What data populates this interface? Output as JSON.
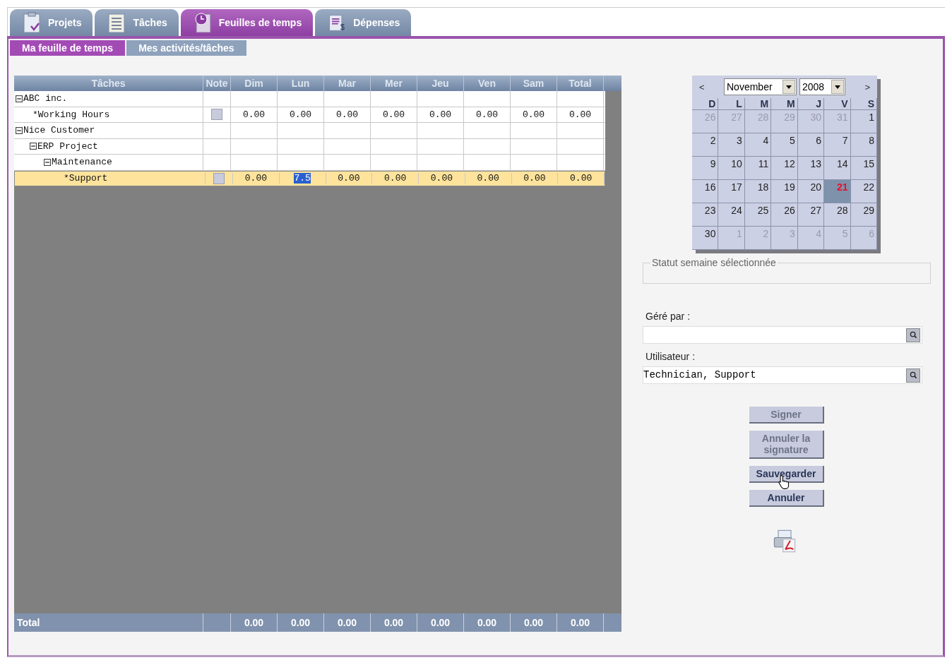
{
  "tabs": [
    {
      "label": "Projets",
      "selected": false
    },
    {
      "label": "Tâches",
      "selected": false
    },
    {
      "label": "Feuilles de temps",
      "selected": true
    },
    {
      "label": "Dépenses",
      "selected": false
    }
  ],
  "subtabs": [
    {
      "label": "Ma feuille de temps",
      "selected": true
    },
    {
      "label": "Mes activités/tâches",
      "selected": false
    }
  ],
  "grid": {
    "columns": [
      "Tâches",
      "Note",
      "Dim",
      "Lun",
      "Mar",
      "Mer",
      "Jeu",
      "Ven",
      "Sam",
      "Total"
    ],
    "rows": [
      {
        "kind": "group",
        "label": "ABC inc.",
        "expanded": true,
        "children": [
          {
            "kind": "task",
            "label": "*Working Hours",
            "selected": false,
            "cells": [
              {
                "text": "0.00",
                "editing": false
              },
              {
                "text": "0.00",
                "editing": false
              },
              {
                "text": "0.00",
                "editing": false
              },
              {
                "text": "0.00",
                "editing": false
              },
              {
                "text": "0.00",
                "editing": false
              },
              {
                "text": "0.00",
                "editing": false
              },
              {
                "text": "0.00",
                "editing": false
              },
              {
                "text": "0.00",
                "editing": false
              }
            ]
          }
        ]
      },
      {
        "kind": "group",
        "label": "Nice Customer",
        "expanded": true,
        "children": [
          {
            "kind": "group",
            "label": "ERP Project",
            "expanded": true,
            "children": [
              {
                "kind": "group",
                "label": "Maintenance",
                "expanded": true,
                "children": [
                  {
                    "kind": "task",
                    "label": "*Support",
                    "selected": true,
                    "cells": [
                      {
                        "text": "0.00",
                        "editing": false
                      },
                      {
                        "text": "7.5",
                        "editing": true
                      },
                      {
                        "text": "0.00",
                        "editing": false
                      },
                      {
                        "text": "0.00",
                        "editing": false
                      },
                      {
                        "text": "0.00",
                        "editing": false
                      },
                      {
                        "text": "0.00",
                        "editing": false
                      },
                      {
                        "text": "0.00",
                        "editing": false
                      },
                      {
                        "text": "0.00",
                        "editing": false
                      }
                    ]
                  }
                ]
              }
            ]
          }
        ]
      }
    ],
    "total": {
      "label": "Total",
      "values": [
        "0.00",
        "0.00",
        "0.00",
        "0.00",
        "0.00",
        "0.00",
        "0.00",
        "0.00"
      ]
    }
  },
  "calendar": {
    "prev": "<",
    "next": ">",
    "month": "November",
    "year": "2008",
    "weekdays": [
      "D",
      "L",
      "M",
      "M",
      "J",
      "V",
      "S"
    ],
    "weeks": [
      [
        {
          "text": "26",
          "outside": true,
          "selected": false
        },
        {
          "text": "27",
          "outside": true,
          "selected": false
        },
        {
          "text": "28",
          "outside": true,
          "selected": false
        },
        {
          "text": "29",
          "outside": true,
          "selected": false
        },
        {
          "text": "30",
          "outside": true,
          "selected": false
        },
        {
          "text": "31",
          "outside": true,
          "selected": false
        },
        {
          "text": "1",
          "outside": false,
          "selected": false
        }
      ],
      [
        {
          "text": "2",
          "outside": false,
          "selected": false
        },
        {
          "text": "3",
          "outside": false,
          "selected": false
        },
        {
          "text": "4",
          "outside": false,
          "selected": false
        },
        {
          "text": "5",
          "outside": false,
          "selected": false
        },
        {
          "text": "6",
          "outside": false,
          "selected": false
        },
        {
          "text": "7",
          "outside": false,
          "selected": false
        },
        {
          "text": "8",
          "outside": false,
          "selected": false
        }
      ],
      [
        {
          "text": "9",
          "outside": false,
          "selected": false
        },
        {
          "text": "10",
          "outside": false,
          "selected": false
        },
        {
          "text": "11",
          "outside": false,
          "selected": false
        },
        {
          "text": "12",
          "outside": false,
          "selected": false
        },
        {
          "text": "13",
          "outside": false,
          "selected": false
        },
        {
          "text": "14",
          "outside": false,
          "selected": false
        },
        {
          "text": "15",
          "outside": false,
          "selected": false
        }
      ],
      [
        {
          "text": "16",
          "outside": false,
          "selected": false
        },
        {
          "text": "17",
          "outside": false,
          "selected": false
        },
        {
          "text": "18",
          "outside": false,
          "selected": false
        },
        {
          "text": "19",
          "outside": false,
          "selected": false
        },
        {
          "text": "20",
          "outside": false,
          "selected": false
        },
        {
          "text": "21",
          "outside": false,
          "selected": true
        },
        {
          "text": "22",
          "outside": false,
          "selected": false
        }
      ],
      [
        {
          "text": "23",
          "outside": false,
          "selected": false
        },
        {
          "text": "24",
          "outside": false,
          "selected": false
        },
        {
          "text": "25",
          "outside": false,
          "selected": false
        },
        {
          "text": "26",
          "outside": false,
          "selected": false
        },
        {
          "text": "27",
          "outside": false,
          "selected": false
        },
        {
          "text": "28",
          "outside": false,
          "selected": false
        },
        {
          "text": "29",
          "outside": false,
          "selected": false
        }
      ],
      [
        {
          "text": "30",
          "outside": false,
          "selected": false
        },
        {
          "text": "1",
          "outside": true,
          "selected": false
        },
        {
          "text": "2",
          "outside": true,
          "selected": false
        },
        {
          "text": "3",
          "outside": true,
          "selected": false
        },
        {
          "text": "4",
          "outside": true,
          "selected": false
        },
        {
          "text": "5",
          "outside": true,
          "selected": false
        },
        {
          "text": "6",
          "outside": true,
          "selected": false
        }
      ]
    ]
  },
  "status": {
    "legend": "Statut semaine sélectionnée"
  },
  "fields": [
    {
      "label": "Géré par :"
    },
    {
      "label": "Utilisateur :",
      "value": "Technician, Support"
    }
  ],
  "buttons": [
    {
      "label": "Signer",
      "disabled": true,
      "hovered": false
    },
    {
      "label": "Annuler la signature",
      "disabled": true,
      "hovered": false
    },
    {
      "label": "Sauvegarder",
      "disabled": false,
      "hovered": true
    },
    {
      "label": "Annuler",
      "disabled": false,
      "hovered": false
    }
  ]
}
